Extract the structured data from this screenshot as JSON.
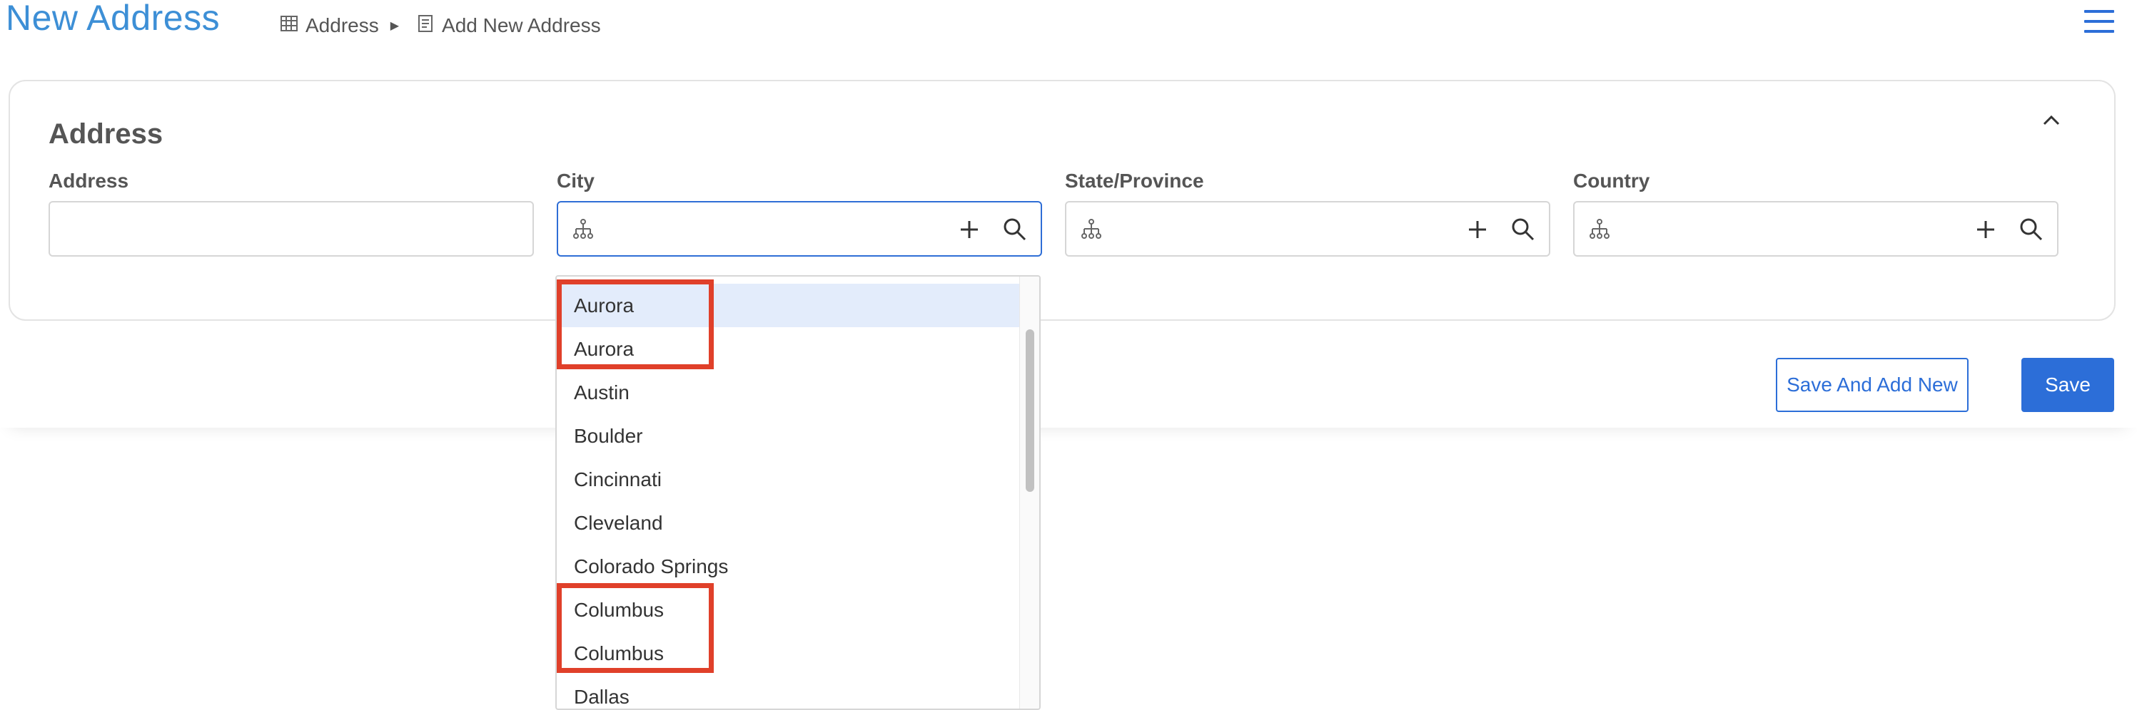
{
  "header": {
    "title": "New Address",
    "breadcrumb": [
      {
        "label": "Address",
        "icon": "table-icon"
      },
      {
        "label": "Add New Address",
        "icon": "document-icon"
      }
    ]
  },
  "card": {
    "title": "Address",
    "fields": {
      "address": {
        "label": "Address",
        "value": ""
      },
      "city": {
        "label": "City",
        "value": ""
      },
      "state": {
        "label": "State/Province",
        "value": ""
      },
      "country": {
        "label": "Country",
        "value": ""
      }
    }
  },
  "dropdown": {
    "items": [
      "Aurora",
      "Aurora",
      "Austin",
      "Boulder",
      "Cincinnati",
      "Cleveland",
      "Colorado Springs",
      "Columbus",
      "Columbus",
      "Dallas"
    ],
    "highlighted_index": 0
  },
  "actions": {
    "save_and_add_new": "Save And Add New",
    "save": "Save"
  },
  "colors": {
    "accent": "#2c6ed8",
    "title": "#3d8fd6",
    "annotation": "#e0402a",
    "highlight_row": "#e3ecfb"
  }
}
